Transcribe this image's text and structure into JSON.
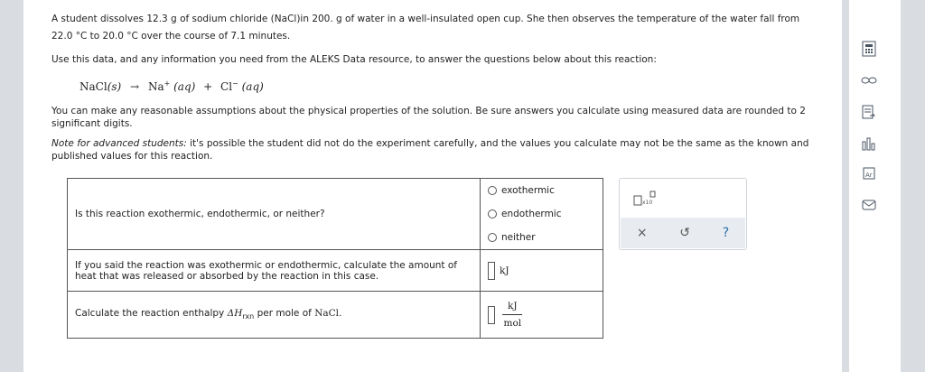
{
  "problem": {
    "line1": "A student dissolves 12.3 g of sodium chloride (NaCl)in 200. g of water in a well-insulated open cup. She then observes the temperature of the water fall from",
    "line2": "22.0 °C to 20.0 °C over the course of 7.1 minutes.",
    "use_data": "Use this data, and any information you need from the ALEKS Data resource, to answer the questions below about this reaction:",
    "equation": {
      "reactant": "NaCl",
      "reactant_state": "(s)",
      "arrow": "→",
      "product1": "Na",
      "product1_charge": "+",
      "product1_state": "(aq)",
      "plus": "+",
      "product2": "Cl",
      "product2_charge": "−",
      "product2_state": "(aq)"
    },
    "assumptions_line1": "You can make any reasonable assumptions about the physical properties of the solution. Be sure answers you calculate using measured data are rounded to 2",
    "assumptions_line2": "significant digits.",
    "note_label": "Note for advanced students:",
    "note_line1": " it's possible the student did not do the experiment carefully, and the values you calculate may not be the same as the known and",
    "note_line2": "published values for this reaction."
  },
  "questions": {
    "q1": {
      "text": "Is this reaction exothermic, endothermic, or neither?",
      "options": [
        "exothermic",
        "endothermic",
        "neither"
      ]
    },
    "q2": {
      "text_line1": "If you said the reaction was exothermic or endothermic, calculate the amount of",
      "text_line2": "heat that was released or absorbed by the reaction in this case.",
      "unit": "kJ"
    },
    "q3": {
      "text_prefix": "Calculate the reaction enthalpy ",
      "symbol": "ΔH",
      "subscript": "rxn",
      "text_suffix": " per mole of ",
      "compound": "NaCl.",
      "unit_numerator": "kJ",
      "unit_denominator": "mol"
    }
  },
  "toolbox": {
    "sci_label": "x10",
    "clear_icon": "×",
    "undo_icon": "↺",
    "help_icon": "?"
  },
  "sidebar_icons": [
    "calculator-icon",
    "link-icon",
    "notes-icon",
    "chart-icon",
    "periodic-table-icon",
    "mail-icon"
  ],
  "colors": {
    "background": "#d9dde2",
    "panel": "#ffffff",
    "toolbar": "#e8ecf0",
    "help": "#2a6fb0"
  }
}
